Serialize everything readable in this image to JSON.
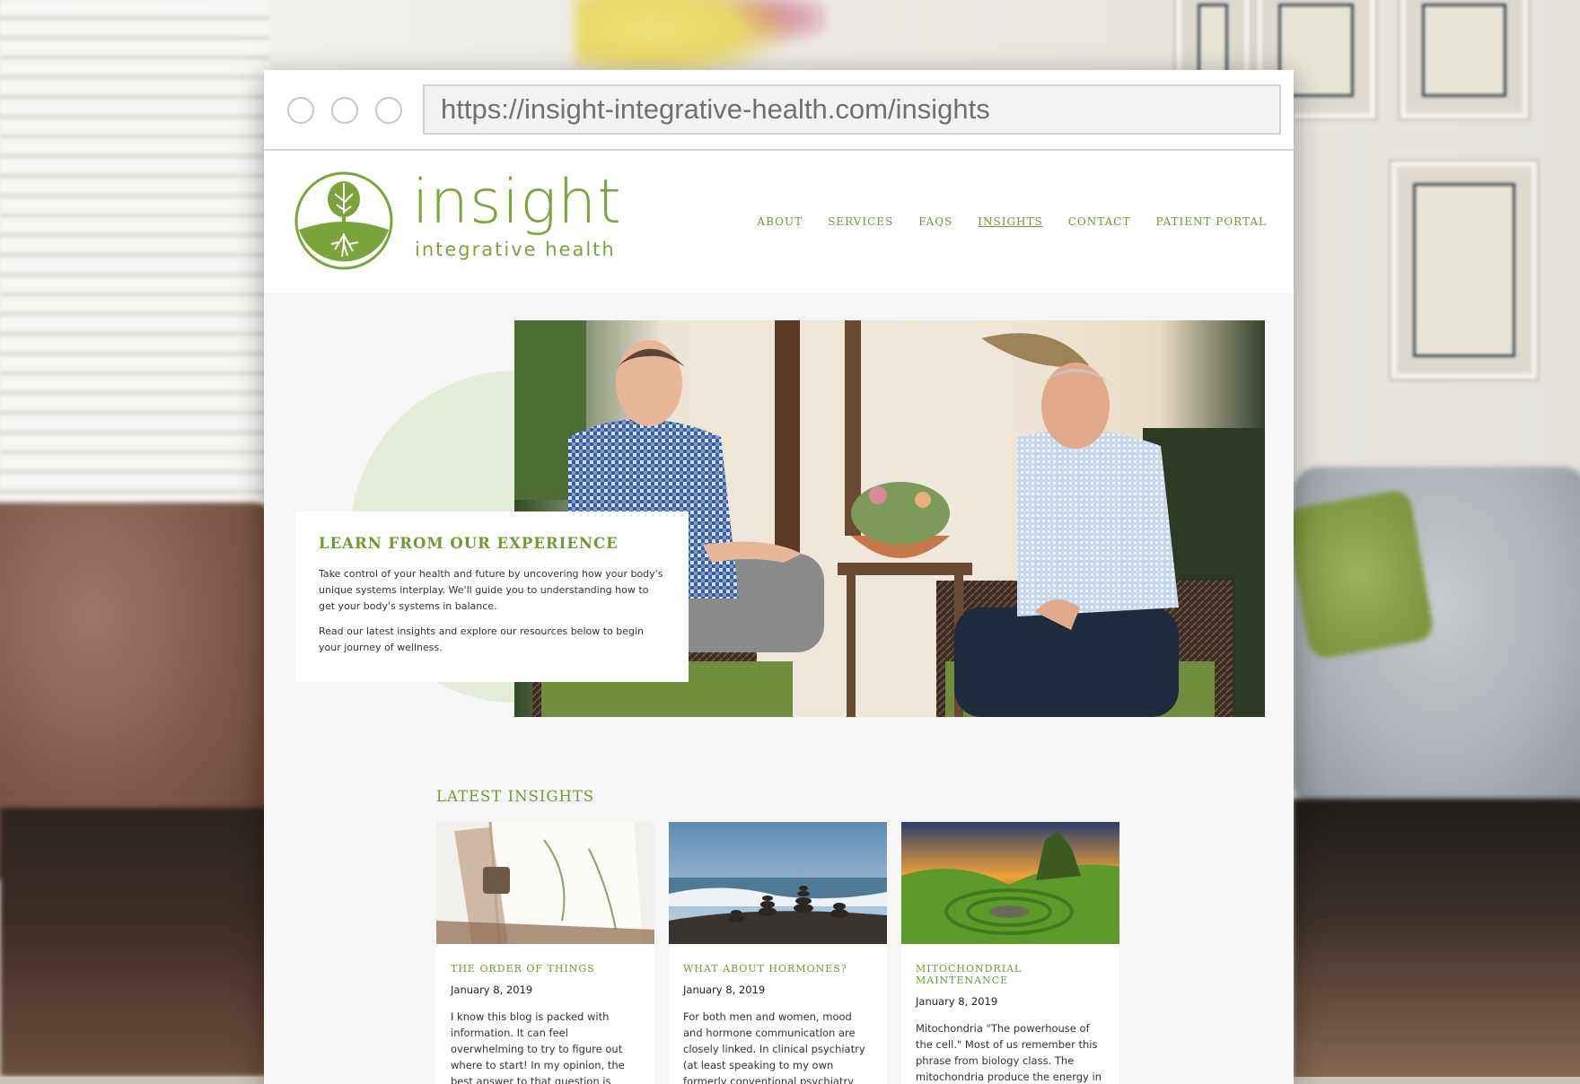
{
  "browser": {
    "url": "https://insight-integrative-health.com/insights"
  },
  "site": {
    "brand": "insight",
    "brand_sub": "integrative health",
    "nav": [
      {
        "label": "ABOUT"
      },
      {
        "label": "SERVICES"
      },
      {
        "label": "FAQS"
      },
      {
        "label": "INSIGHTS",
        "active": true
      },
      {
        "label": "CONTACT"
      },
      {
        "label": "PATIENT PORTAL"
      }
    ],
    "accent_color": "#6f9a2e"
  },
  "hero": {
    "title": "LEARN FROM OUR EXPERIENCE",
    "paragraph_1": "Take control of your health and future by uncovering how your body's unique systems interplay. We'll guide you to understanding how to get your body's systems in balance.",
    "paragraph_2": "Read our latest insights and explore our resources below to begin your journey of wellness."
  },
  "insights": {
    "heading": "LATEST INSIGHTS",
    "cards": [
      {
        "title": "THE ORDER OF THINGS",
        "date": "January 8, 2019",
        "excerpt": "I know this blog is packed with information. It can feel overwhelming to try to figure out where to start! In my opinion, the best answer to that question is"
      },
      {
        "title": "WHAT ABOUT HORMONES?",
        "date": "January 8, 2019",
        "excerpt": "For both men and women, mood and hormone communication are closely linked. In clinical psychiatry (at least speaking to my own formerly conventional psychiatry"
      },
      {
        "title": "MITOCHONDRIAL MAINTENANCE",
        "date": "January 8, 2019",
        "excerpt": "Mitochondria \"The powerhouse of the cell.\" Most of us remember this phrase from biology class. The mitochondria produce the energy in"
      }
    ]
  }
}
